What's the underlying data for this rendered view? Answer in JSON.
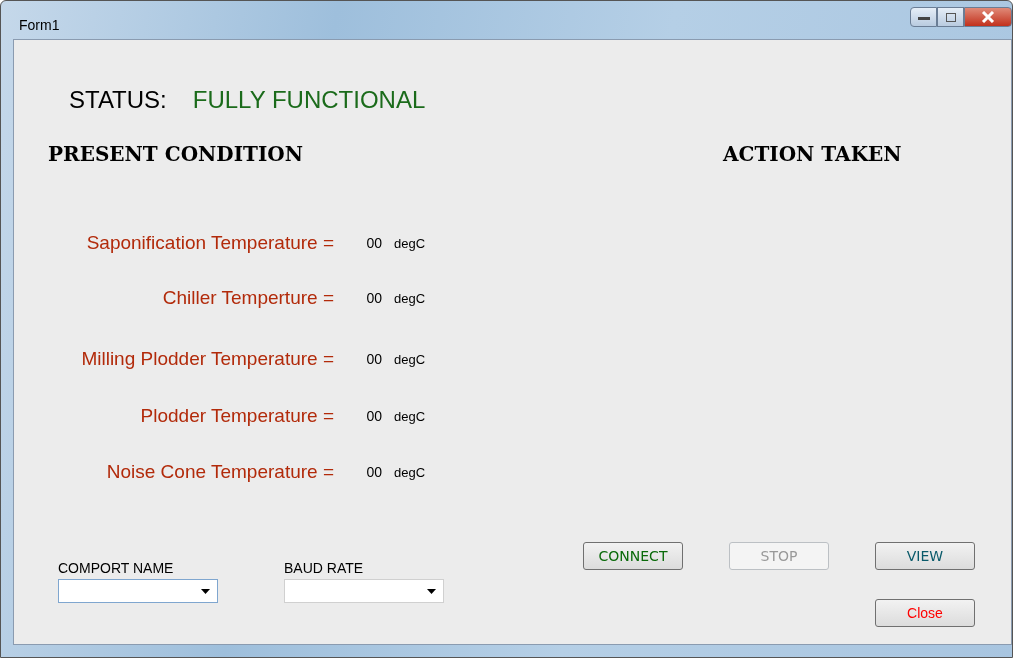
{
  "window": {
    "title": "Form1"
  },
  "status": {
    "label": "STATUS:",
    "value": "FULLY FUNCTIONAL"
  },
  "present_condition": {
    "heading": "PRESENT CONDITION",
    "readings": [
      {
        "label": "Saponification Temperature =",
        "value": "00",
        "unit": "degC"
      },
      {
        "label": "Chiller Temperture =",
        "value": "00",
        "unit": "degC"
      },
      {
        "label": "Milling Plodder Temperature =",
        "value": "00",
        "unit": "degC"
      },
      {
        "label": "Plodder Temperature =",
        "value": "00",
        "unit": "degC"
      },
      {
        "label": "Noise Cone Temperature =",
        "value": "00",
        "unit": "degC"
      }
    ]
  },
  "action_taken": {
    "heading": "ACTION TAKEN"
  },
  "dropdowns": [
    {
      "label": "COMPORT NAME",
      "focused": true
    },
    {
      "label": "BAUD RATE",
      "focused": false
    }
  ],
  "buttons": [
    {
      "label": "CONNECT",
      "color": "#0a6a0a",
      "disabled": false
    },
    {
      "label": "STOP",
      "color": "#999999",
      "disabled": true
    },
    {
      "label": "VIEW",
      "color": "#0a5a6a",
      "disabled": false
    },
    {
      "label": "Close",
      "color": "#ff0000",
      "disabled": false
    }
  ]
}
